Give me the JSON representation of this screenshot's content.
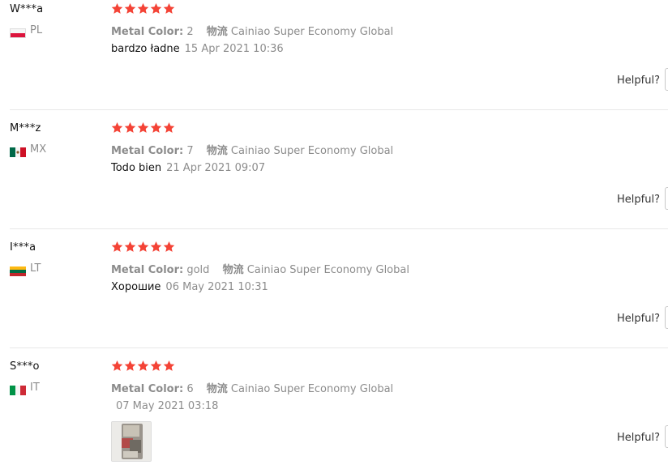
{
  "reviews": [
    {
      "user": "W***a",
      "country": "PL",
      "rating": 5,
      "meta_color_label": "Metal Color:",
      "meta_color_value": "2",
      "meta_ship_label": "物流",
      "meta_ship_value": "Cainiao Super Economy Global",
      "text": "bardzo ładne",
      "date": "15 Apr 2021 10:36",
      "helpful_label": "Helpful?"
    },
    {
      "user": "M***z",
      "country": "MX",
      "rating": 5,
      "meta_color_label": "Metal Color:",
      "meta_color_value": "7",
      "meta_ship_label": "物流",
      "meta_ship_value": "Cainiao Super Economy Global",
      "text": "Todo bien",
      "date": "21 Apr 2021 09:07",
      "helpful_label": "Helpful?"
    },
    {
      "user": "I***a",
      "country": "LT",
      "rating": 5,
      "meta_color_label": "Metal Color:",
      "meta_color_value": "gold",
      "meta_ship_label": "物流",
      "meta_ship_value": "Cainiao Super Economy Global",
      "text": "Хорошие",
      "date": "06 May 2021 10:31",
      "helpful_label": "Helpful?"
    },
    {
      "user": "S***o",
      "country": "IT",
      "rating": 5,
      "meta_color_label": "Metal Color:",
      "meta_color_value": "6",
      "meta_ship_label": "物流",
      "meta_ship_value": "Cainiao Super Economy Global",
      "text": "",
      "date": "07 May 2021 03:18",
      "helpful_label": "Helpful?"
    }
  ],
  "colors": {
    "star": "#f44336",
    "muted": "#8c8c8c",
    "divider": "#e8e8e8"
  },
  "icons": {
    "star": "star-icon",
    "flag_pl": "flag-pl-icon",
    "flag_mx": "flag-mx-icon",
    "flag_lt": "flag-lt-icon",
    "flag_it": "flag-it-icon"
  }
}
